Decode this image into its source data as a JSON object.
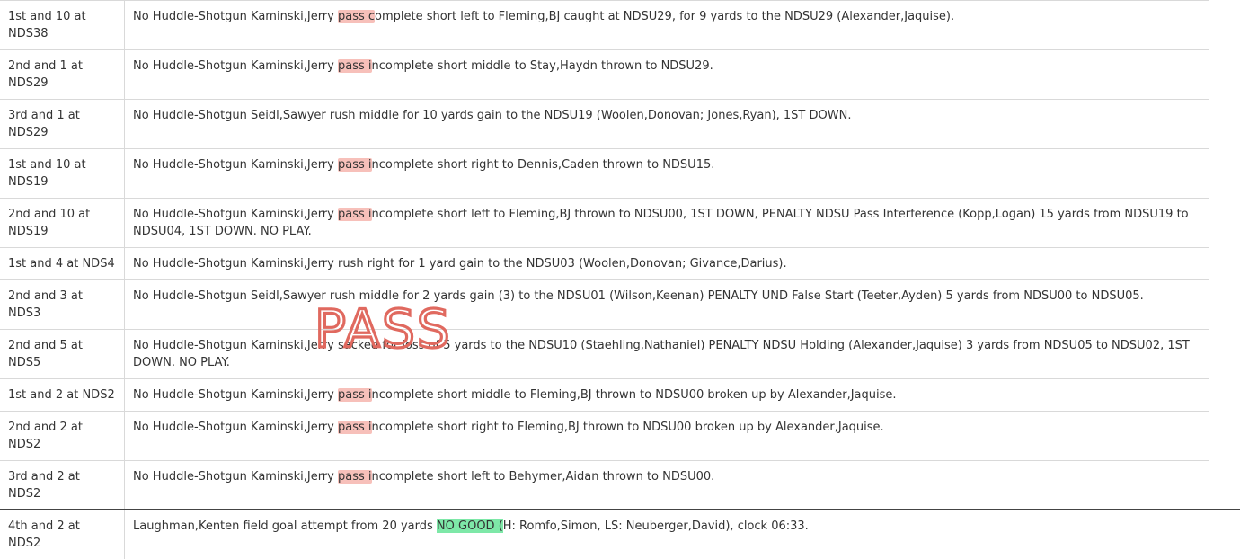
{
  "annotation": {
    "text": "PASS",
    "color": "#e0695f"
  },
  "highlight_colors": {
    "pass": "#f08c82",
    "good": "#7ee8a8"
  },
  "rows": [
    {
      "situation": "1st and 10 at NDS38",
      "segments": [
        {
          "t": "No Huddle-Shotgun Kaminski,Jerry "
        },
        {
          "t": "pass c",
          "h": "pass"
        },
        {
          "t": "omplete short left to Fleming,BJ caught at NDSU29, for 9 yards to the NDSU29 (Alexander,Jaquise)."
        }
      ]
    },
    {
      "situation": "2nd and 1 at NDS29",
      "segments": [
        {
          "t": "No Huddle-Shotgun Kaminski,Jerry "
        },
        {
          "t": "pass i",
          "h": "pass"
        },
        {
          "t": "ncomplete short middle to Stay,Haydn thrown to NDSU29."
        }
      ]
    },
    {
      "situation": "3rd and 1 at NDS29",
      "segments": [
        {
          "t": "No Huddle-Shotgun Seidl,Sawyer rush middle for 10 yards gain to the NDSU19 (Woolen,Donovan; Jones,Ryan), 1ST DOWN."
        }
      ]
    },
    {
      "situation": "1st and 10 at NDS19",
      "segments": [
        {
          "t": "No Huddle-Shotgun Kaminski,Jerry "
        },
        {
          "t": "pass i",
          "h": "pass"
        },
        {
          "t": "ncomplete short right to Dennis,Caden thrown to NDSU15."
        }
      ]
    },
    {
      "situation": "2nd and 10 at NDS19",
      "segments": [
        {
          "t": "No Huddle-Shotgun Kaminski,Jerry "
        },
        {
          "t": "pass i",
          "h": "pass"
        },
        {
          "t": "ncomplete short left to Fleming,BJ thrown to NDSU00, 1ST DOWN, PENALTY NDSU Pass Interference (Kopp,Logan) 15 yards from NDSU19 to NDSU04, 1ST DOWN. NO PLAY."
        }
      ]
    },
    {
      "situation": "1st and 4 at NDS4",
      "segments": [
        {
          "t": "No Huddle-Shotgun Kaminski,Jerry rush right for 1 yard gain to the NDSU03 (Woolen,Donovan; Givance,Darius)."
        }
      ]
    },
    {
      "situation": "2nd and 3 at NDS3",
      "segments": [
        {
          "t": "No Huddle-Shotgun Seidl,Sawyer rush middle for 2 yards gain (3) to the NDSU01 (Wilson,Keenan) PENALTY UND False Start (Teeter,Ayden) 5 yards from NDSU00 to NDSU05."
        }
      ]
    },
    {
      "situation": "2nd and 5 at NDS5",
      "segments": [
        {
          "t": "No Huddle-Shotgun Kaminski,Jerry sacked for loss of 5 yards to the NDSU10 (Staehling,Nathaniel) PENALTY NDSU Holding (Alexander,Jaquise) 3 yards from NDSU05 to NDSU02, 1ST DOWN. NO PLAY."
        }
      ]
    },
    {
      "situation": "1st and 2 at NDS2",
      "segments": [
        {
          "t": "No Huddle-Shotgun Kaminski,Jerry "
        },
        {
          "t": "pass i",
          "h": "pass"
        },
        {
          "t": "ncomplete short middle to Fleming,BJ thrown to NDSU00 broken up by Alexander,Jaquise."
        }
      ]
    },
    {
      "situation": "2nd and 2 at NDS2",
      "segments": [
        {
          "t": "No Huddle-Shotgun Kaminski,Jerry "
        },
        {
          "t": "pass i",
          "h": "pass"
        },
        {
          "t": "ncomplete short right to Fleming,BJ thrown to NDSU00 broken up by Alexander,Jaquise."
        }
      ]
    },
    {
      "situation": "3rd and 2 at NDS2",
      "segments": [
        {
          "t": "No Huddle-Shotgun Kaminski,Jerry "
        },
        {
          "t": "pass i",
          "h": "pass"
        },
        {
          "t": "ncomplete short left to Behymer,Aidan thrown to NDSU00."
        }
      ]
    },
    {
      "situation": "4th and 2 at NDS2",
      "segments": [
        {
          "t": "Laughman,Kenten field goal attempt from 20 yards "
        },
        {
          "t": "NO GOOD (",
          "h": "good"
        },
        {
          "t": "H: Romfo,Simon, LS: Neuberger,David), clock 06:33."
        }
      ]
    }
  ]
}
